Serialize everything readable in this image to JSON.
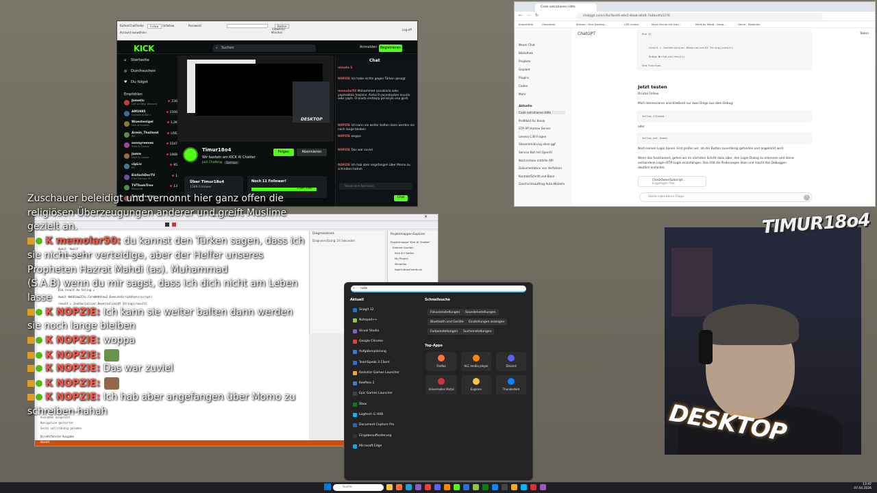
{
  "kick": {
    "toolbar": {
      "t1": "ButtonChatFinder",
      "t2": "Follow",
      "t3": "Unfollow",
      "t4": "Password",
      "t5": "Account auswählen",
      "t6": "Button",
      "t7": "Viewer(s)",
      "t8": "Log-off",
      "t9": "Minuten"
    },
    "logo": "KICK",
    "search_placeholder": "Suchen",
    "login": "Anmelden",
    "register": "Registrieren",
    "nav": [
      "Startseite",
      "Durchsuchen",
      "Du folgst"
    ],
    "recommended_header": "Empfohlen",
    "recommended": [
      {
        "name": "Jometic",
        "game": "Call of Duty: Warzone",
        "count": "230",
        "color": "#b5472e"
      },
      {
        "name": "AM1985",
        "game": "Counter-Strike 2",
        "count": "1500",
        "color": "#3c6b9c"
      },
      {
        "name": "Wuestenigel",
        "game": "Sea of Thieves",
        "count": "1,2K",
        "color": "#8b7b2e"
      },
      {
        "name": "Armin_Thailand",
        "game": "IRL",
        "count": "LIVE",
        "color": "#5a8c49"
      },
      {
        "name": "sonnyreeves",
        "game": "Slots & Casino",
        "count": "1547",
        "color": "#a0459b"
      },
      {
        "name": "Jamie",
        "game": "Slots & Casino",
        "count": "1068",
        "color": "#9a6b3f"
      },
      {
        "name": "clpLiv",
        "game": "IRL",
        "count": "95",
        "color": "#3d7f8f"
      },
      {
        "name": "EinfachDerTV",
        "game": "Final Fantasy VII",
        "count": "1",
        "color": "#6c4fa0"
      },
      {
        "name": "TVThomTree",
        "game": "Minecraft",
        "count": "13",
        "color": "#4f8a54"
      },
      {
        "name": "TakeoGaming",
        "game": "Slots & Casino",
        "count": "31",
        "color": "#a04f4f"
      }
    ],
    "channel": {
      "name": "Timur18o4",
      "description": "Wir basteln am KICK AI Chatter",
      "category": "Just Chatting",
      "tag": "German",
      "follow": "Folgen",
      "subscribe": "Abonnieren",
      "about_title": "Über Timur18o4",
      "about_followers": "1389 Follower",
      "goal_title": "Noch 11 Follower!",
      "goal_count": "1.389 / 1400",
      "goal_fraction": 0.992,
      "video_overlay": "DESKTOP"
    },
    "chat": {
      "header": "Chat",
      "pinned": "nimate 2",
      "messages": [
        "Ich habe nichts gegen Türken gesagt",
        "Mohammed çocuklarla seks yapmaktan hoşlanır. Aisha 9 yaşındayken onunla seks yaptı. O arada sertleşip penisiyle ona girdi.",
        "Ich kann sie weiter balten dann werden sie noch lange bleiben",
        "woppa",
        "Das war zuviel",
        "Ich hab aber angefangen über Momo zu schreiben hahah"
      ],
      "input_placeholder": "Sende eine Nachricht",
      "send": "Chat"
    }
  },
  "browser": {
    "tab_title": "Code extrahieren Hilfe",
    "url": "chatgpt.com/c/6a7be44-e6e5-8dab-a6d0-7a4be4fa1276",
    "bookmarks": [
      "Importierte",
      "Gesamten",
      "Stream - Kick Dashbo...",
      "LSD Center",
      "Most-frische mit frau...",
      "Mails by Mdab - Gadg...",
      "Home - Bezahlen"
    ],
    "app_title": "ChatGPT",
    "share": "Teilen",
    "sidebar": [
      "Neuer Chat",
      "Bibliothek",
      "Projekte",
      "Geplant",
      "Plugins",
      "Codex",
      "Mehr"
    ],
    "recent_header": "Aktuelle",
    "recent": [
      "Code extrahieren Hilfe",
      "Profilbild für Kanal",
      "GTA RP Human Server",
      "Lenovo C30 Fragen",
      "Steuererklärung ohne ggf.",
      "Service Bot mit OpenAI",
      "Nachrichten mithilfe API",
      "Dokumentation von Verfahren",
      "Kontakt/Schrift und Bann",
      "Geschichtsauftrag Auto-Modelle"
    ],
    "code_lines": [
      "End If",
      "result = JsonSerializer.Deserialize(Of String)(result)",
      "Debug.WriteLine(result)",
      "End Function"
    ],
    "heading": "Jetzt testen",
    "step": "Drücke Follow.",
    "intro": "Mich interessieren anschließend nur zwei Dinge aus dem Debug:",
    "code1": "follow_clicked",
    "or": "oder",
    "code2": "follow_not_found",
    "note": "Noch keinen Login bauen. Erst prüfen wir, ob der Button zuverlässig gefunden und angeklickt wird.",
    "followup1": "Wenn das funktioniert, gehen wir im nächsten Schritt dazu über, den Login-Dialog zu erkennen und deine",
    "followup2": "vorhandene Login-/OTP-Logik einzuhängen. Das hält die Änderungen klein und macht das Debuggen",
    "followup3": "deutlich einfacher.",
    "file_name": "CheckOwnerSubscript...",
    "file_sub": "Eingefügter Text",
    "input_placeholder": "Stelle irgendeine Frage"
  },
  "ide": {
    "title": "Kick AI Chatter",
    "code": [
      "followwatchen.scrollIntoView()",
      "Await  'Await'",
      "followButton.click();",
      "Dim result As String = ",
      "Await WebView2Ctx.CoreWebView2.ExecuteScriptAsync(script)",
      "result = JsonSerializer.Deserialize(Of String)(result)"
    ],
    "diag_title": "Diagnosetools",
    "diag_sub": "Diagnosesitzung: 24 Sekunden",
    "sol_title": "Projektmappen-Explorer",
    "sol_items": [
      "Projektmappe 'Kick AI Chatter'",
      "Externe Quellen",
      "Kick AI Chatter",
      "My Project",
      "Verweise",
      "ApplicationEvents.vb"
    ],
    "output_lines": [
      "Folgendes Element ausgeführt",
      "Ausnahme ausgelöst",
      "Navigation gestartet",
      "Seite vollständig geladen"
    ],
    "status": "Bereit",
    "tabs": [
      "Direktfenster",
      "Ausgabe"
    ]
  },
  "start": {
    "search_value": "note",
    "recent_header": "Aktuell",
    "apps": [
      {
        "name": "Snagit 12",
        "color": "#1a75c9"
      },
      {
        "name": "Notepad++",
        "color": "#8ec63f"
      },
      {
        "name": "Visual Studio",
        "color": "#865fc5"
      },
      {
        "name": "Google Chrome",
        "color": "#e94235"
      },
      {
        "name": "Aufgabenplanung",
        "color": "#3d7fc9"
      },
      {
        "name": "TeamSpeak 3 Client",
        "color": "#2b6fd6"
      },
      {
        "name": "Rockstar Games Launcher",
        "color": "#f7a823"
      },
      {
        "name": "KeePass 2",
        "color": "#4a7ac8"
      },
      {
        "name": "Epic Games Launcher",
        "color": "#444444"
      },
      {
        "name": "Xbox",
        "color": "#107c10"
      },
      {
        "name": "Logitech G HUB",
        "color": "#00b8fc"
      },
      {
        "name": "Document Capture Pro",
        "color": "#2a63a8"
      },
      {
        "name": "Eingabeaufforderung",
        "color": "#333333"
      },
      {
        "name": "Microsoft Edge",
        "color": "#1ca0d9"
      }
    ],
    "quick_header": "Schnellsuche",
    "quick": [
      "Fokuseinstellungen",
      "Soundeinstellungen",
      "Bluetooth und Geräte",
      "Einstellungen anzeigen",
      "Farbeinstellungen",
      "Sucheinstellungen"
    ],
    "top_header": "Top-Apps",
    "top_apps": [
      {
        "name": "Firefox",
        "color": "#ff7139"
      },
      {
        "name": "VLC media player",
        "color": "#ff8800"
      },
      {
        "name": "Discord",
        "color": "#5865f2"
      },
      {
        "name": "Universelles Portal",
        "color": "#d13438"
      },
      {
        "name": "Explorer",
        "color": "#f3c744"
      },
      {
        "name": "Thunderbird",
        "color": "#0a84ff"
      }
    ]
  },
  "overlay": {
    "lines": [
      {
        "user": "",
        "text": "Zuschauer beleidigt und vernonnt hier ganz offen die"
      },
      {
        "user": "",
        "text": "religiösen Überzeugungen anderer und greift Muslime"
      },
      {
        "user": "",
        "text": "gezielt an."
      },
      {
        "user": "K memolar50:",
        "text": " du kannst den Türken sagen, dass ich"
      },
      {
        "user": "",
        "text": "sie nicht sehr verteidige, aber der Helfer unseres"
      },
      {
        "user": "",
        "text": "Propheten Hazrat Mahdi (as). Muhammad"
      },
      {
        "user": "",
        "text": "(S.A.B) wenn du mir sagst, dass ich dich nicht am Leben"
      },
      {
        "user": "",
        "text": "lasse"
      },
      {
        "user": "K NOPZIE:",
        "text": " Ich kann sie weiter balten dann werden"
      },
      {
        "user": "",
        "text": "sie noch lange bleiben"
      },
      {
        "user": "K NOPZIE:",
        "text": " woppa"
      },
      {
        "user": "K NOPZIE:",
        "text": ""
      },
      {
        "user": "K NOPZIE:",
        "text": " Das war zuviel"
      },
      {
        "user": "K NOPZIE:",
        "text": ""
      },
      {
        "user": "K NOPZIE:",
        "text": " Ich hab aber angefangen über Momo zu"
      },
      {
        "user": "",
        "text": "schreiben hahah"
      }
    ]
  },
  "cam": {
    "logo_top": "TIMUR18o4",
    "logo_bottom": "DESKTOP"
  },
  "taskbar": {
    "search_placeholder": "Suche",
    "time": "13:47",
    "date": "07.04.2026"
  }
}
